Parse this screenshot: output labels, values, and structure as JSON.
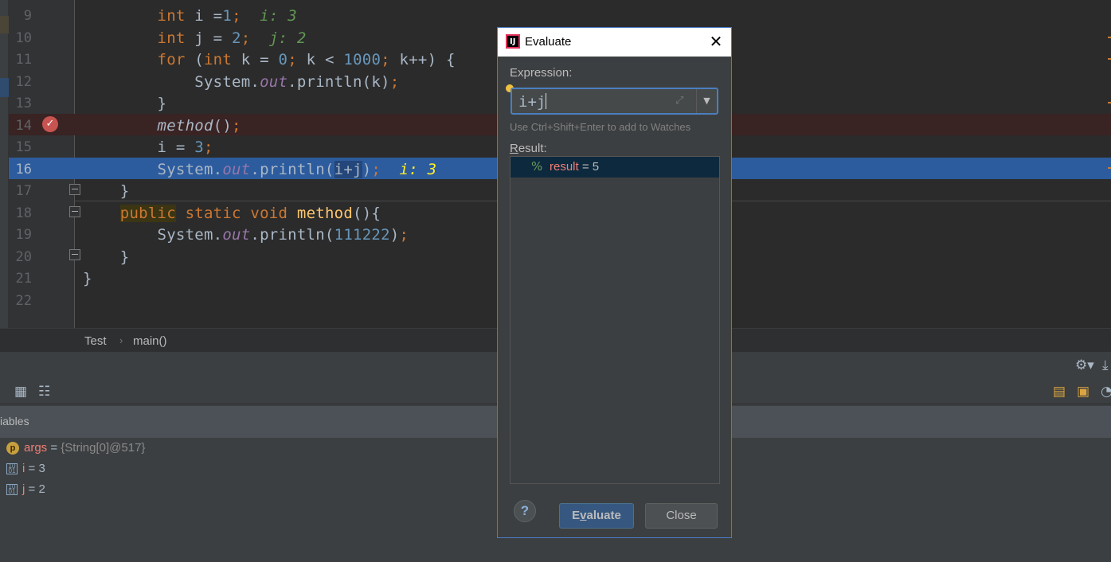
{
  "editor": {
    "lines": [
      {
        "num": "9",
        "parts": [
          [
            "",
            "        "
          ],
          [
            "kw",
            "int"
          ],
          [
            "",
            " i ="
          ],
          [
            "num",
            "1"
          ],
          [
            "kw",
            ";"
          ],
          [
            "",
            "  "
          ],
          [
            "hint",
            "i: 3"
          ]
        ]
      },
      {
        "num": "10",
        "parts": [
          [
            "",
            "        "
          ],
          [
            "kw",
            "int"
          ],
          [
            "",
            " j = "
          ],
          [
            "num",
            "2"
          ],
          [
            "kw",
            ";"
          ],
          [
            "",
            "  "
          ],
          [
            "hint",
            "j: 2"
          ]
        ]
      },
      {
        "num": "11",
        "parts": [
          [
            "",
            "        "
          ],
          [
            "kw",
            "for"
          ],
          [
            "",
            " ("
          ],
          [
            "kw",
            "int"
          ],
          [
            "",
            " k = "
          ],
          [
            "num",
            "0"
          ],
          [
            "kw",
            ";"
          ],
          [
            "",
            " k < "
          ],
          [
            "num",
            "1000"
          ],
          [
            "kw",
            ";"
          ],
          [
            "",
            " k++) {"
          ]
        ]
      },
      {
        "num": "12",
        "parts": [
          [
            "",
            "            System."
          ],
          [
            "fld",
            "out"
          ],
          [
            "",
            ".println(k)"
          ],
          [
            "kw",
            ";"
          ]
        ]
      },
      {
        "num": "13",
        "parts": [
          [
            "",
            "        }"
          ]
        ]
      },
      {
        "num": "14",
        "parts": [
          [
            "",
            "        "
          ],
          [
            "itl",
            "method"
          ],
          [
            "",
            "()"
          ],
          [
            "kw",
            ";"
          ]
        ]
      },
      {
        "num": "15",
        "parts": [
          [
            "",
            "        i = "
          ],
          [
            "num",
            "3"
          ],
          [
            "kw",
            ";"
          ]
        ]
      },
      {
        "num": "16",
        "parts": [
          [
            "",
            "        System."
          ],
          [
            "fld",
            "out"
          ],
          [
            "",
            ".println("
          ],
          [
            "selhl",
            "i+j"
          ],
          [
            "",
            ")"
          ],
          [
            "kw",
            ";"
          ],
          [
            "",
            "  "
          ],
          [
            "hint-exec",
            "i: 3"
          ]
        ]
      },
      {
        "num": "17",
        "parts": [
          [
            "",
            "    }"
          ]
        ]
      },
      {
        "num": "18",
        "parts": [
          [
            "",
            "    "
          ],
          [
            "kw pubhl",
            "public"
          ],
          [
            "",
            " "
          ],
          [
            "kw",
            "static void"
          ],
          [
            "",
            " "
          ],
          [
            "mth",
            "method"
          ],
          [
            "",
            "(){"
          ]
        ]
      },
      {
        "num": "19",
        "parts": [
          [
            "",
            "        System."
          ],
          [
            "fld",
            "out"
          ],
          [
            "",
            ".println("
          ],
          [
            "num",
            "111222"
          ],
          [
            "",
            ")"
          ],
          [
            "kw",
            ";"
          ]
        ]
      },
      {
        "num": "20",
        "parts": [
          [
            "",
            "    }"
          ]
        ]
      },
      {
        "num": "21",
        "parts": [
          [
            "",
            "}"
          ]
        ]
      },
      {
        "num": "22",
        "parts": []
      }
    ],
    "breakpoint_line": "14",
    "execution_line": "16"
  },
  "breadcrumb": {
    "class_name": "Test",
    "separator": "›",
    "method_name": "main()"
  },
  "debug": {
    "variables_header": "iables",
    "variables": [
      {
        "icon": "p",
        "name": "args",
        "eq": " = ",
        "value": "{String[0]@517}"
      },
      {
        "icon": "b",
        "name": "i",
        "eq": " = ",
        "value": "3"
      },
      {
        "icon": "b",
        "name": "j",
        "eq": " = ",
        "value": "2"
      }
    ]
  },
  "dialog": {
    "title": "Evaluate",
    "expression_label": "Expression:",
    "expression_value": "i+j",
    "hint": "Use Ctrl+Shift+Enter to add to Watches",
    "result_label_first": "R",
    "result_label_rest": "esult:",
    "result_name": "result",
    "result_value": " = 5",
    "help_label": "?",
    "evaluate_label_first": "E",
    "evaluate_label_second": "v",
    "evaluate_label_rest": "aluate",
    "close_label": "Close"
  },
  "colors": {
    "accent": "#4a7bc7",
    "execution_line": "#2d5c9e",
    "breakpoint": "#c75450"
  }
}
